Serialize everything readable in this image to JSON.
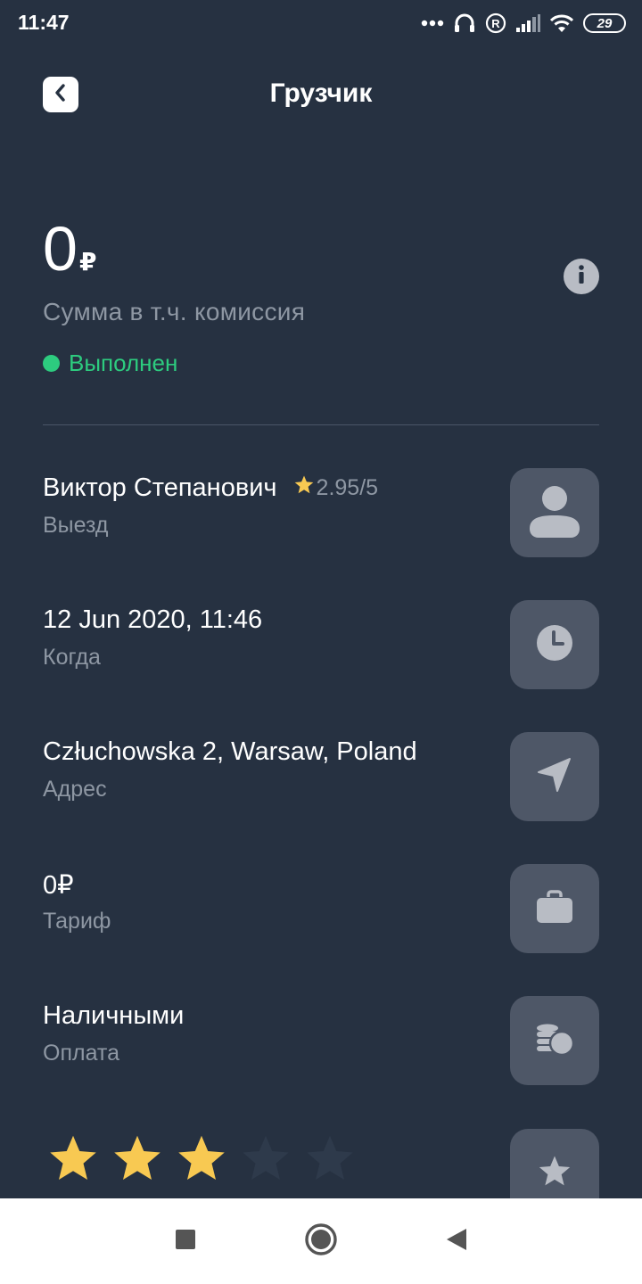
{
  "status_bar": {
    "time": "11:47",
    "battery": "29"
  },
  "header": {
    "title": "Грузчик"
  },
  "summary": {
    "amount": "0",
    "currency": "₽",
    "caption": "Сумма в т.ч. комиссия",
    "status": "Выполнен",
    "status_color": "#2dcc7f"
  },
  "rows": [
    {
      "title": "Виктор Степанович",
      "rating": "2.95/5",
      "subtitle": "Выезд",
      "icon": "person-icon"
    },
    {
      "title": "12 Jun 2020, 11:46",
      "subtitle": "Когда",
      "icon": "clock-icon"
    },
    {
      "title": "Człuchowska 2, Warsaw, Poland",
      "subtitle": "Адрес",
      "icon": "navigation-arrow-icon"
    },
    {
      "title": "0₽",
      "subtitle": "Тариф",
      "icon": "briefcase-icon"
    },
    {
      "title": "Наличными",
      "subtitle": "Оплата",
      "icon": "coins-icon"
    }
  ],
  "user_rating": {
    "value": 3,
    "max": 5,
    "filled_color": "#f8c952",
    "empty_color": "#2e3a4b"
  },
  "colors": {
    "background": "#263141",
    "card_button": "#4e5767",
    "muted_text": "#8e97a3",
    "accent_star": "#f8c952"
  }
}
